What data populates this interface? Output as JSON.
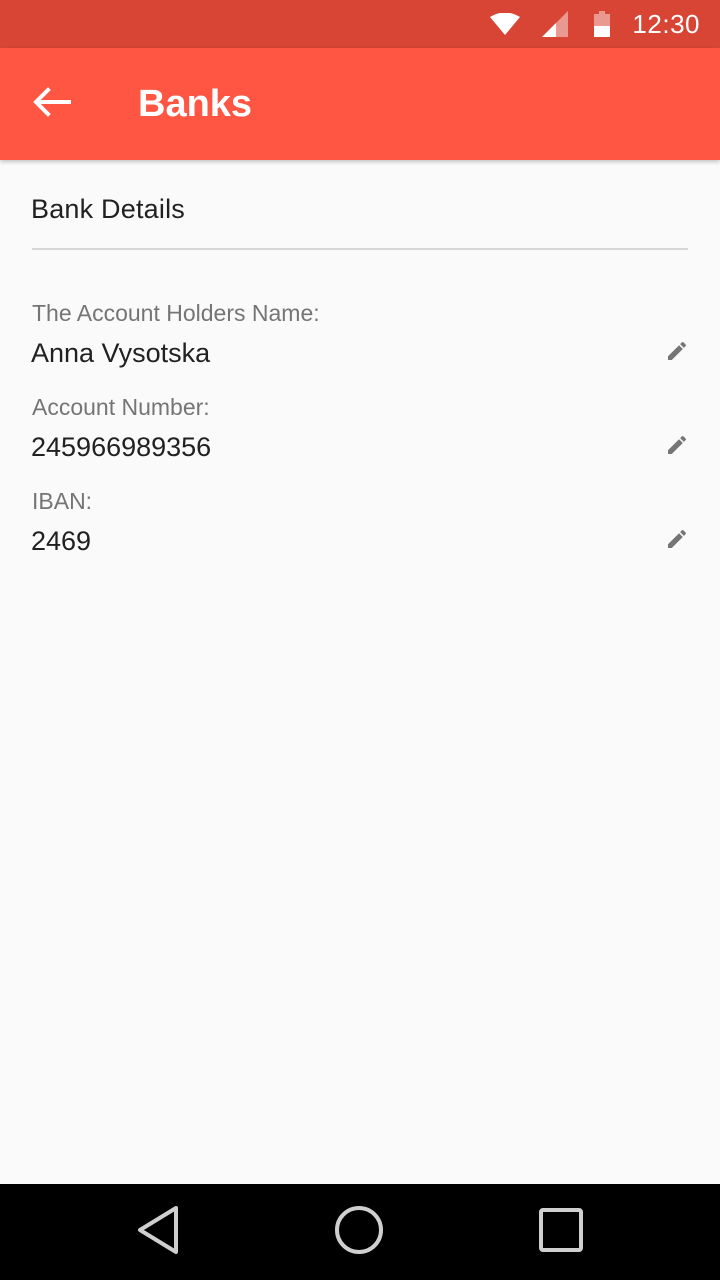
{
  "status_bar": {
    "time": "12:30",
    "icons": [
      "wifi-icon",
      "signal-icon",
      "battery-icon"
    ]
  },
  "app_bar": {
    "title": "Banks",
    "back_icon": "arrow-back-icon"
  },
  "section": {
    "title": "Bank Details"
  },
  "fields": [
    {
      "label": "The Account Holders Name:",
      "value": "Anna Vysotska",
      "action_icon": "pencil-edit-icon"
    },
    {
      "label": "Account Number:",
      "value": "245966989356",
      "action_icon": "pencil-edit-icon"
    },
    {
      "label": "IBAN:",
      "value": "2469",
      "action_icon": "pencil-edit-icon"
    }
  ],
  "nav_bar": {
    "buttons": [
      "back-triangle-icon",
      "home-circle-icon",
      "recents-square-icon"
    ]
  },
  "colors": {
    "status_bar": "#d84535",
    "app_bar": "#ff5543",
    "background": "#fafafa",
    "label_text": "#757575",
    "value_text": "#212121",
    "icon": "#757575"
  }
}
